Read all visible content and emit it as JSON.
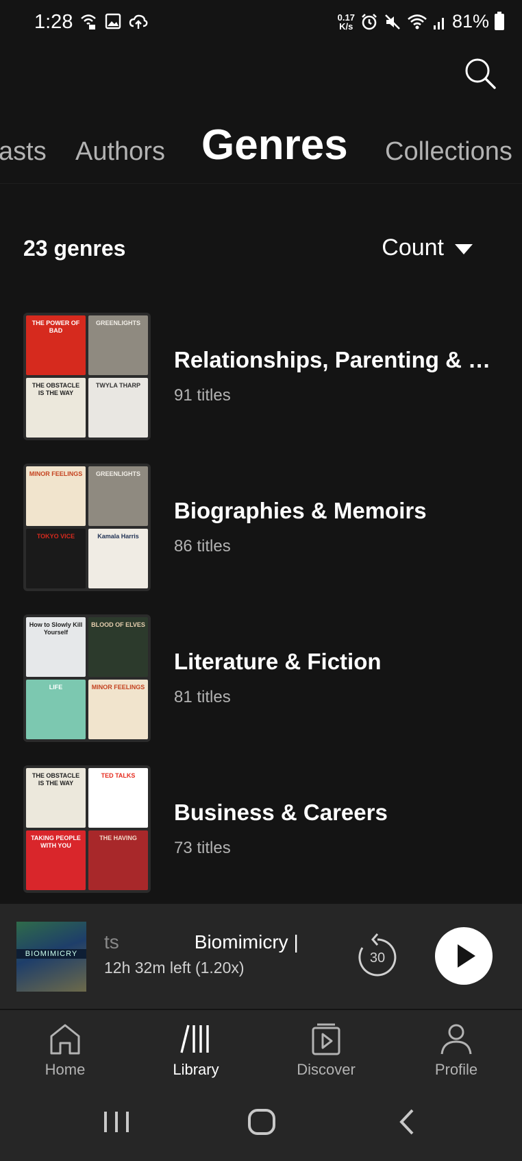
{
  "status_bar": {
    "time": "1:28",
    "net_speed_value": "0.17",
    "net_speed_unit": "K/s",
    "battery": "81%",
    "left_icons": [
      "wifi-calling-icon",
      "image-icon",
      "cloud-upload-icon"
    ],
    "right_icons": [
      "alarm-icon",
      "mute-icon",
      "wifi-icon",
      "signal-icon",
      "battery-icon"
    ]
  },
  "header": {
    "search_icon": "search-icon"
  },
  "tabs": [
    {
      "label": "asts",
      "active": false
    },
    {
      "label": "Authors",
      "active": false
    },
    {
      "label": "Genres",
      "active": true
    },
    {
      "label": "Collections",
      "active": false
    }
  ],
  "list_header": {
    "count_label": "23 genres",
    "sort_label": "Count"
  },
  "genres": [
    {
      "name": "Relationships, Parenting & Pe…",
      "count": "91 titles",
      "covers": [
        {
          "text": "THE POWER OF BAD",
          "bg": "#d62a1e",
          "fg": "#ffffff"
        },
        {
          "text": "GREENLIGHTS",
          "bg": "#8f8a80",
          "fg": "#f2efe8"
        },
        {
          "text": "THE OBSTACLE IS THE WAY",
          "bg": "#ece8dc",
          "fg": "#222222"
        },
        {
          "text": "TWYLA THARP",
          "bg": "#e9e7e2",
          "fg": "#333333"
        }
      ]
    },
    {
      "name": "Biographies & Memoirs",
      "count": "86 titles",
      "covers": [
        {
          "text": "MINOR FEELINGS",
          "bg": "#f1e4cd",
          "fg": "#c4421f"
        },
        {
          "text": "GREENLIGHTS",
          "bg": "#8f8a80",
          "fg": "#f2efe8"
        },
        {
          "text": "TOKYO VICE",
          "bg": "#1a1a1a",
          "fg": "#d62a1e"
        },
        {
          "text": "Kamala Harris",
          "bg": "#f0ece4",
          "fg": "#223355"
        }
      ]
    },
    {
      "name": "Literature & Fiction",
      "count": "81 titles",
      "covers": [
        {
          "text": "How to Slowly Kill Yourself",
          "bg": "#e6e8ea",
          "fg": "#222222"
        },
        {
          "text": "BLOOD OF ELVES",
          "bg": "#2c3a2c",
          "fg": "#e8d0b0"
        },
        {
          "text": "LIFE",
          "bg": "#7cc8b0",
          "fg": "#ffffff"
        },
        {
          "text": "MINOR FEELINGS",
          "bg": "#f1e4cd",
          "fg": "#c4421f"
        }
      ]
    },
    {
      "name": "Business & Careers",
      "count": "73 titles",
      "covers": [
        {
          "text": "THE OBSTACLE IS THE WAY",
          "bg": "#ece8dc",
          "fg": "#222222"
        },
        {
          "text": "TED TALKS",
          "bg": "#ffffff",
          "fg": "#e62b1e"
        },
        {
          "text": "TAKING PEOPLE WITH YOU",
          "bg": "#d9262b",
          "fg": "#ffffff"
        },
        {
          "text": "THE HAVING",
          "bg": "#a8282a",
          "fg": "#f2d8c8"
        }
      ]
    }
  ],
  "player": {
    "cover_text": "BIOMIMICRY",
    "title_prefix": "ts",
    "title": "Biomimicry | ",
    "time_left": "12h 32m left (1.20x)",
    "skip_seconds": "30"
  },
  "bottom_nav": [
    {
      "label": "Home",
      "icon": "home-icon",
      "active": false
    },
    {
      "label": "Library",
      "icon": "library-icon",
      "active": true
    },
    {
      "label": "Discover",
      "icon": "discover-icon",
      "active": false
    },
    {
      "label": "Profile",
      "icon": "profile-icon",
      "active": false
    }
  ],
  "colors": {
    "background": "#141414",
    "panel": "#262626",
    "muted_text": "#b3b3b3"
  }
}
